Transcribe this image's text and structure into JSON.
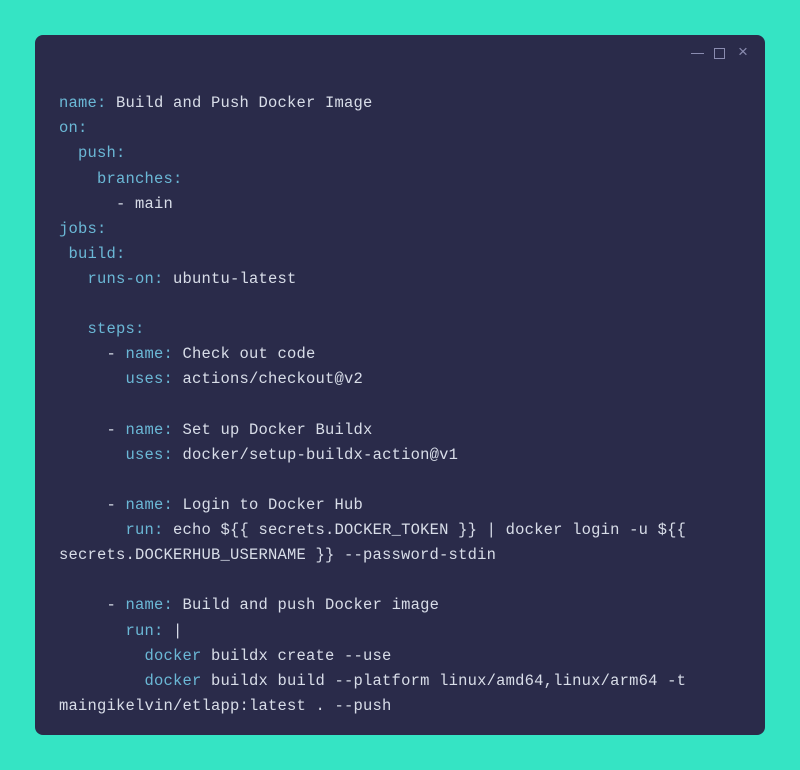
{
  "yaml": {
    "name_key": "name:",
    "name_val": " Build and Push Docker Image",
    "on_key": "on:",
    "push_key": "  push:",
    "branches_key": "    branches:",
    "branches_dash": "      - ",
    "branches_val": "main",
    "jobs_key": "jobs:",
    "build_key": " build:",
    "runs_on_key": "   runs-on:",
    "runs_on_val": " ubuntu-latest",
    "steps_key": "   steps:",
    "step1_dash": "     - ",
    "step1_name_key": "name:",
    "step1_name_val": " Check out code",
    "step1_uses_pad": "       ",
    "step1_uses_key": "uses:",
    "step1_uses_val": " actions/checkout@v2",
    "step2_dash": "     - ",
    "step2_name_key": "name:",
    "step2_name_val": " Set up Docker Buildx",
    "step2_uses_pad": "       ",
    "step2_uses_key": "uses:",
    "step2_uses_val": " docker/setup-buildx-action@v1",
    "step3_dash": "     - ",
    "step3_name_key": "name:",
    "step3_name_val": " Login to Docker Hub",
    "step3_run_pad": "       ",
    "step3_run_key": "run:",
    "step3_run_val": " echo ${{ secrets.DOCKER_TOKEN }} | docker login -u ${{ ",
    "step3_run_val2": "secrets.DOCKERHUB_USERNAME }} --password-stdin",
    "step4_dash": "     - ",
    "step4_name_key": "name:",
    "step4_name_val": " Build and push Docker image",
    "step4_run_pad": "       ",
    "step4_run_key": "run:",
    "step4_run_val": " |",
    "step4_cmd1_pad": "         ",
    "step4_cmd1_key": "docker",
    "step4_cmd1_val": " buildx create --use",
    "step4_cmd2_pad": "         ",
    "step4_cmd2_key": "docker",
    "step4_cmd2_val": " buildx build --platform linux/amd64,linux/arm64 -t ",
    "step4_cmd2_val2": "maingikelvin/etlapp:latest . --push"
  }
}
